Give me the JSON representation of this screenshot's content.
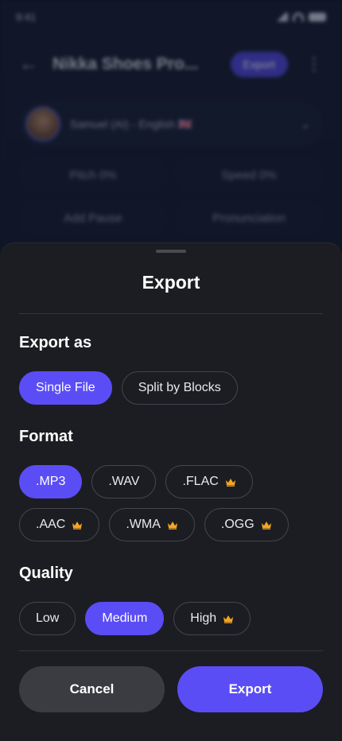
{
  "background": {
    "status_time": "9:41",
    "project_title": "Nikka Shoes Pro...",
    "export_pill": "Export",
    "voice_label": "Samuel (AI) - English 🇬🇧",
    "controls": [
      "Pitch 0%",
      "Speed 0%",
      "Add Pause",
      "Pronunciation"
    ]
  },
  "sheet": {
    "title": "Export",
    "export_as": {
      "label": "Export as",
      "options": [
        {
          "label": "Single File",
          "selected": true,
          "premium": false
        },
        {
          "label": "Split by Blocks",
          "selected": false,
          "premium": false
        }
      ]
    },
    "format": {
      "label": "Format",
      "row1": [
        {
          "label": ".MP3",
          "selected": true,
          "premium": false
        },
        {
          "label": ".WAV",
          "selected": false,
          "premium": false
        },
        {
          "label": ".FLAC",
          "selected": false,
          "premium": true
        }
      ],
      "row2": [
        {
          "label": ".AAC",
          "selected": false,
          "premium": true
        },
        {
          "label": ".WMA",
          "selected": false,
          "premium": true
        },
        {
          "label": ".OGG",
          "selected": false,
          "premium": true
        }
      ]
    },
    "quality": {
      "label": "Quality",
      "options": [
        {
          "label": "Low",
          "selected": false,
          "premium": false
        },
        {
          "label": "Medium",
          "selected": true,
          "premium": false
        },
        {
          "label": "High",
          "selected": false,
          "premium": true
        }
      ]
    },
    "cancel_label": "Cancel",
    "export_label": "Export"
  },
  "icons": {
    "back": "arrow-left-icon",
    "kebab": "more-vertical-icon",
    "chevron": "chevron-down-icon",
    "crown": "crown-icon"
  },
  "colors": {
    "accent": "#5b4df5",
    "crown": "#f5a623",
    "sheet_bg": "#1c1d22",
    "cancel_bg": "#3b3c42"
  }
}
